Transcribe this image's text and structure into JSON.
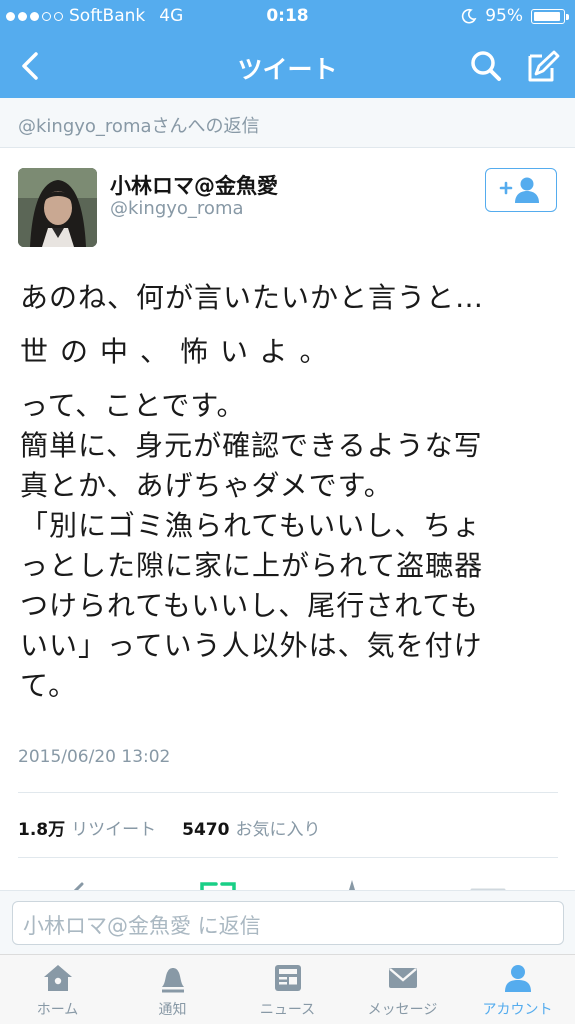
{
  "status_bar": {
    "carrier": "SoftBank",
    "network": "4G",
    "time": "0:18",
    "battery": "95%",
    "battery_level": 0.95
  },
  "nav": {
    "title": "ツイート",
    "icons": [
      "chevron-left-icon",
      "search-icon",
      "compose-icon"
    ]
  },
  "reply_context": "@kingyo_romaさんへの返信",
  "tweet": {
    "display_name": "小林ロマ@金魚愛",
    "handle": "@kingyo_roma",
    "lines": [
      "あのね、何が言いたいかと言うと…",
      "世の中、怖いよ。",
      "って、ことです。",
      "簡単に、身元が確認できるような写",
      "真とか、あげちゃダメです。",
      "「別にゴミ漁られてもいいし、ちょ",
      "っとした隙に家に上がられて盗聴器",
      "つけられてもいいし、尾行されても",
      "いい」っていう人以外は、気を付け",
      "て。"
    ],
    "timestamp": "2015/06/20 13:02"
  },
  "stats": {
    "retweets_count": "1.8万",
    "retweets_label": "リツイート",
    "favorites_count": "5470",
    "favorites_label": "お気に入り"
  },
  "reply_input": {
    "placeholder": "小林ロマ@金魚愛 に返信"
  },
  "tabs": [
    {
      "label": "ホーム",
      "icon": "home-icon",
      "active": false
    },
    {
      "label": "通知",
      "icon": "bell-icon",
      "active": false
    },
    {
      "label": "ニュース",
      "icon": "news-icon",
      "active": false
    },
    {
      "label": "メッセージ",
      "icon": "envelope-icon",
      "active": false
    },
    {
      "label": "アカウント",
      "icon": "account-icon",
      "active": true
    }
  ],
  "colors": {
    "accent": "#55acee",
    "muted": "#8899a6",
    "text": "#1a1a1a"
  }
}
